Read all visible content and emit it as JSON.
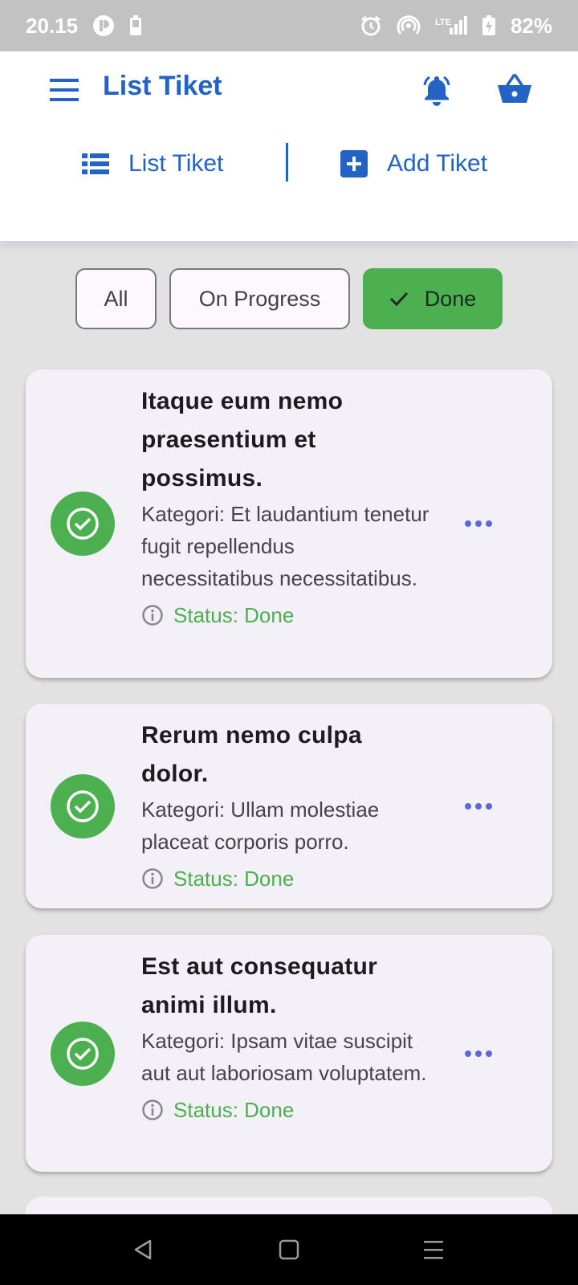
{
  "status_bar": {
    "time": "20.15",
    "network": "LTE",
    "battery": "82%"
  },
  "app_bar": {
    "title": "List Tiket",
    "icons": [
      "menu-icon",
      "bell-icon",
      "basket-icon"
    ]
  },
  "nav": {
    "list_label": "List Tiket",
    "add_label": "Add Tiket"
  },
  "filters": [
    {
      "label": "All",
      "selected": false
    },
    {
      "label": "On Progress",
      "selected": false
    },
    {
      "label": "Done",
      "selected": true
    }
  ],
  "tickets": [
    {
      "title": "Itaque eum nemo praesentium et possimus.",
      "category": "Kategori: Et laudantium tenetur fugit repellendus necessitatibus necessitatibus.",
      "status": "Status: Done"
    },
    {
      "title": "Rerum nemo culpa dolor.",
      "category": "Kategori: Ullam molestiae placeat corporis porro.",
      "status": "Status: Done"
    },
    {
      "title": "Est aut consequatur animi illum.",
      "category": "Kategori: Ipsam vitae suscipit aut aut laboriosam voluptatem.",
      "status": "Status: Done"
    }
  ],
  "colors": {
    "primary": "#2363c3",
    "done_green": "#4caf50",
    "card_bg": "#f4f0f7",
    "page_bg": "#e2e2e2",
    "more_dots": "#5b6ad8"
  }
}
